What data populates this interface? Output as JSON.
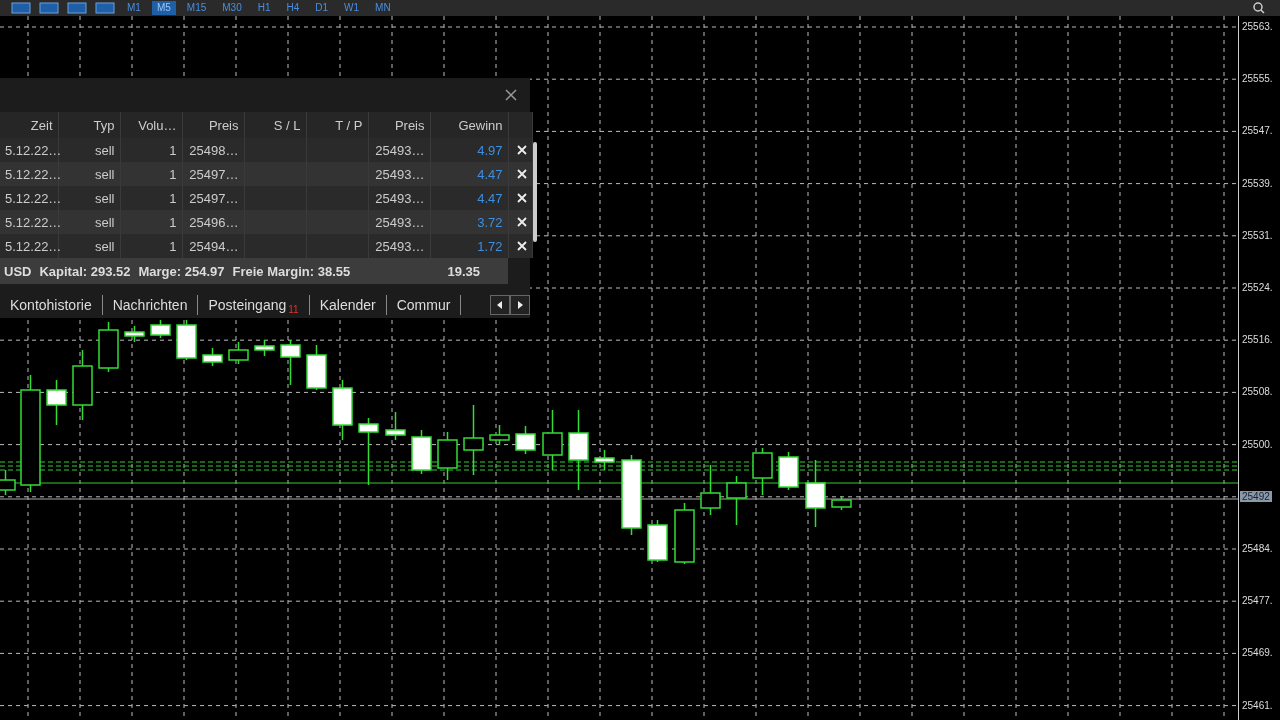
{
  "toolbar": {
    "timeframes": [
      {
        "label": "M1",
        "selected": false
      },
      {
        "label": "M5",
        "selected": true
      },
      {
        "label": "M15",
        "selected": false
      },
      {
        "label": "M30",
        "selected": false
      },
      {
        "label": "H1",
        "selected": false
      },
      {
        "label": "H4",
        "selected": false
      },
      {
        "label": "D1",
        "selected": false
      },
      {
        "label": "W1",
        "selected": false
      },
      {
        "label": "MN",
        "selected": false
      }
    ]
  },
  "chart": {
    "price_labels": [
      {
        "label": "25563.",
        "current": false
      },
      {
        "label": "25555.",
        "current": false
      },
      {
        "label": "25547.",
        "current": false
      },
      {
        "label": "25539.",
        "current": false
      },
      {
        "label": "25531.",
        "current": false
      },
      {
        "label": "25524.",
        "current": false
      },
      {
        "label": "25516.",
        "current": false
      },
      {
        "label": "25508.",
        "current": false
      },
      {
        "label": "25500.",
        "current": false
      },
      {
        "label": "25492",
        "current": true
      },
      {
        "label": "25484.",
        "current": false
      },
      {
        "label": "25477.",
        "current": false
      },
      {
        "label": "25469.",
        "current": false
      },
      {
        "label": "25461.",
        "current": false
      }
    ]
  },
  "trade_panel": {
    "columns": [
      "Zeit",
      "Typ",
      "Volu…",
      "Preis",
      "S / L",
      "T / P",
      "Preis",
      "Gewinn"
    ],
    "rows": [
      {
        "cells": [
          "5.12.22…",
          "sell",
          "1",
          "25498…",
          "",
          "",
          "25493…",
          "4.97"
        ]
      },
      {
        "cells": [
          "5.12.22…",
          "sell",
          "1",
          "25497…",
          "",
          "",
          "25493…",
          "4.47"
        ]
      },
      {
        "cells": [
          "5.12.22…",
          "sell",
          "1",
          "25497…",
          "",
          "",
          "25493…",
          "4.47"
        ]
      },
      {
        "cells": [
          "5.12.22…",
          "sell",
          "1",
          "25496…",
          "",
          "",
          "25493…",
          "3.72"
        ]
      },
      {
        "cells": [
          "5.12.22…",
          "sell",
          "1",
          "25494…",
          "",
          "",
          "25493…",
          "1.72"
        ]
      }
    ],
    "summary": {
      "items": [
        "USD",
        "Kapital: 293.52",
        "Marge: 254.97",
        "Freie Margin: 38.55"
      ],
      "total": "19.35"
    },
    "tabs": [
      {
        "label": "Kontohistorie"
      },
      {
        "label": "Nachrichten"
      },
      {
        "label": "Posteingang",
        "badge": "11"
      },
      {
        "label": "Kalender"
      },
      {
        "label": "Commur"
      }
    ]
  }
}
